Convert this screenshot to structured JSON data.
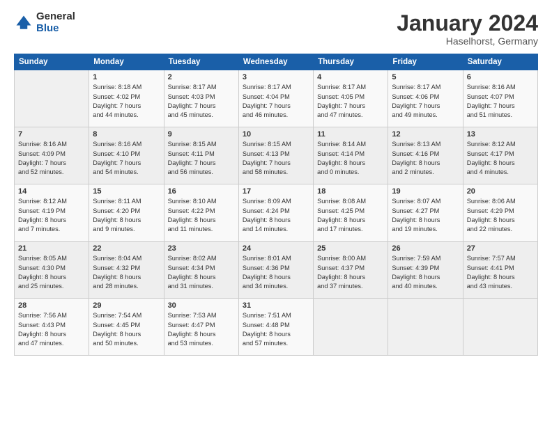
{
  "logo": {
    "general": "General",
    "blue": "Blue"
  },
  "title": "January 2024",
  "subtitle": "Haselhorst, Germany",
  "headers": [
    "Sunday",
    "Monday",
    "Tuesday",
    "Wednesday",
    "Thursday",
    "Friday",
    "Saturday"
  ],
  "weeks": [
    [
      {
        "num": "",
        "info": ""
      },
      {
        "num": "1",
        "info": "Sunrise: 8:18 AM\nSunset: 4:02 PM\nDaylight: 7 hours\nand 44 minutes."
      },
      {
        "num": "2",
        "info": "Sunrise: 8:17 AM\nSunset: 4:03 PM\nDaylight: 7 hours\nand 45 minutes."
      },
      {
        "num": "3",
        "info": "Sunrise: 8:17 AM\nSunset: 4:04 PM\nDaylight: 7 hours\nand 46 minutes."
      },
      {
        "num": "4",
        "info": "Sunrise: 8:17 AM\nSunset: 4:05 PM\nDaylight: 7 hours\nand 47 minutes."
      },
      {
        "num": "5",
        "info": "Sunrise: 8:17 AM\nSunset: 4:06 PM\nDaylight: 7 hours\nand 49 minutes."
      },
      {
        "num": "6",
        "info": "Sunrise: 8:16 AM\nSunset: 4:07 PM\nDaylight: 7 hours\nand 51 minutes."
      }
    ],
    [
      {
        "num": "7",
        "info": "Sunrise: 8:16 AM\nSunset: 4:09 PM\nDaylight: 7 hours\nand 52 minutes."
      },
      {
        "num": "8",
        "info": "Sunrise: 8:16 AM\nSunset: 4:10 PM\nDaylight: 7 hours\nand 54 minutes."
      },
      {
        "num": "9",
        "info": "Sunrise: 8:15 AM\nSunset: 4:11 PM\nDaylight: 7 hours\nand 56 minutes."
      },
      {
        "num": "10",
        "info": "Sunrise: 8:15 AM\nSunset: 4:13 PM\nDaylight: 7 hours\nand 58 minutes."
      },
      {
        "num": "11",
        "info": "Sunrise: 8:14 AM\nSunset: 4:14 PM\nDaylight: 8 hours\nand 0 minutes."
      },
      {
        "num": "12",
        "info": "Sunrise: 8:13 AM\nSunset: 4:16 PM\nDaylight: 8 hours\nand 2 minutes."
      },
      {
        "num": "13",
        "info": "Sunrise: 8:12 AM\nSunset: 4:17 PM\nDaylight: 8 hours\nand 4 minutes."
      }
    ],
    [
      {
        "num": "14",
        "info": "Sunrise: 8:12 AM\nSunset: 4:19 PM\nDaylight: 8 hours\nand 7 minutes."
      },
      {
        "num": "15",
        "info": "Sunrise: 8:11 AM\nSunset: 4:20 PM\nDaylight: 8 hours\nand 9 minutes."
      },
      {
        "num": "16",
        "info": "Sunrise: 8:10 AM\nSunset: 4:22 PM\nDaylight: 8 hours\nand 11 minutes."
      },
      {
        "num": "17",
        "info": "Sunrise: 8:09 AM\nSunset: 4:24 PM\nDaylight: 8 hours\nand 14 minutes."
      },
      {
        "num": "18",
        "info": "Sunrise: 8:08 AM\nSunset: 4:25 PM\nDaylight: 8 hours\nand 17 minutes."
      },
      {
        "num": "19",
        "info": "Sunrise: 8:07 AM\nSunset: 4:27 PM\nDaylight: 8 hours\nand 19 minutes."
      },
      {
        "num": "20",
        "info": "Sunrise: 8:06 AM\nSunset: 4:29 PM\nDaylight: 8 hours\nand 22 minutes."
      }
    ],
    [
      {
        "num": "21",
        "info": "Sunrise: 8:05 AM\nSunset: 4:30 PM\nDaylight: 8 hours\nand 25 minutes."
      },
      {
        "num": "22",
        "info": "Sunrise: 8:04 AM\nSunset: 4:32 PM\nDaylight: 8 hours\nand 28 minutes."
      },
      {
        "num": "23",
        "info": "Sunrise: 8:02 AM\nSunset: 4:34 PM\nDaylight: 8 hours\nand 31 minutes."
      },
      {
        "num": "24",
        "info": "Sunrise: 8:01 AM\nSunset: 4:36 PM\nDaylight: 8 hours\nand 34 minutes."
      },
      {
        "num": "25",
        "info": "Sunrise: 8:00 AM\nSunset: 4:37 PM\nDaylight: 8 hours\nand 37 minutes."
      },
      {
        "num": "26",
        "info": "Sunrise: 7:59 AM\nSunset: 4:39 PM\nDaylight: 8 hours\nand 40 minutes."
      },
      {
        "num": "27",
        "info": "Sunrise: 7:57 AM\nSunset: 4:41 PM\nDaylight: 8 hours\nand 43 minutes."
      }
    ],
    [
      {
        "num": "28",
        "info": "Sunrise: 7:56 AM\nSunset: 4:43 PM\nDaylight: 8 hours\nand 47 minutes."
      },
      {
        "num": "29",
        "info": "Sunrise: 7:54 AM\nSunset: 4:45 PM\nDaylight: 8 hours\nand 50 minutes."
      },
      {
        "num": "30",
        "info": "Sunrise: 7:53 AM\nSunset: 4:47 PM\nDaylight: 8 hours\nand 53 minutes."
      },
      {
        "num": "31",
        "info": "Sunrise: 7:51 AM\nSunset: 4:48 PM\nDaylight: 8 hours\nand 57 minutes."
      },
      {
        "num": "",
        "info": ""
      },
      {
        "num": "",
        "info": ""
      },
      {
        "num": "",
        "info": ""
      }
    ]
  ]
}
